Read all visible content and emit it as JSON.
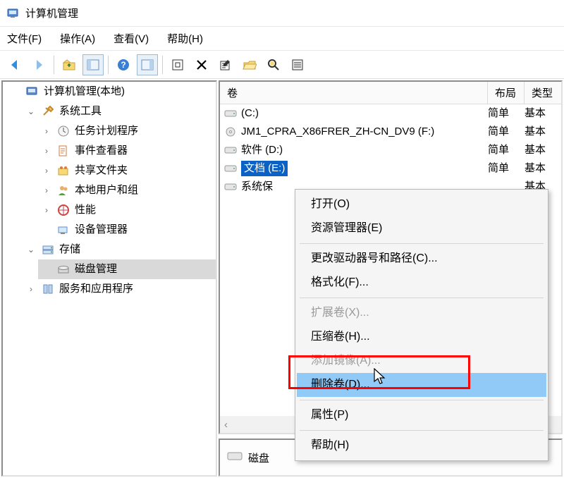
{
  "title": "计算机管理",
  "menus": {
    "file": "文件(F)",
    "action": "操作(A)",
    "view": "查看(V)",
    "help": "帮助(H)"
  },
  "toolbar": {
    "back": "后退",
    "forward": "前进",
    "up": "向上",
    "show_hide": "显示/隐藏",
    "help": "帮助",
    "panel": "面板",
    "refresh": "刷新",
    "delete": "删除",
    "properties": "属性",
    "open": "打开",
    "find": "查找",
    "settings": "设置"
  },
  "tree": {
    "root": "计算机管理(本地)",
    "sys_tools": "系统工具",
    "task_scheduler": "任务计划程序",
    "event_viewer": "事件查看器",
    "shared_folders": "共享文件夹",
    "users_groups": "本地用户和组",
    "performance": "性能",
    "device_mgr": "设备管理器",
    "storage": "存储",
    "disk_mgmt": "磁盘管理",
    "services_apps": "服务和应用程序"
  },
  "list": {
    "headers": {
      "volume": "卷",
      "layout": "布局",
      "type": "类型"
    },
    "rows": [
      {
        "name": "(C:)",
        "layout": "简单",
        "type": "基本",
        "icon": "drive"
      },
      {
        "name": "JM1_CPRA_X86FRER_ZH-CN_DV9 (F:)",
        "layout": "简单",
        "type": "基本",
        "icon": "dvd"
      },
      {
        "name": "软件 (D:)",
        "layout": "简单",
        "type": "基本",
        "icon": "drive"
      },
      {
        "name": "文档 (E:)",
        "layout": "简单",
        "type": "基本",
        "icon": "drive",
        "selected": true
      },
      {
        "name": "系统保",
        "layout": "",
        "type": "基本",
        "icon": "drive"
      }
    ]
  },
  "bottom": {
    "label": "磁盘"
  },
  "context_menu": {
    "open": "打开(O)",
    "explorer": "资源管理器(E)",
    "change_letter": "更改驱动器号和路径(C)...",
    "format": "格式化(F)...",
    "extend": "扩展卷(X)...",
    "shrink": "压缩卷(H)...",
    "add_mirror": "添加镜像(A)...",
    "delete_vol": "删除卷(D)...",
    "properties": "属性(P)",
    "help": "帮助(H)"
  }
}
